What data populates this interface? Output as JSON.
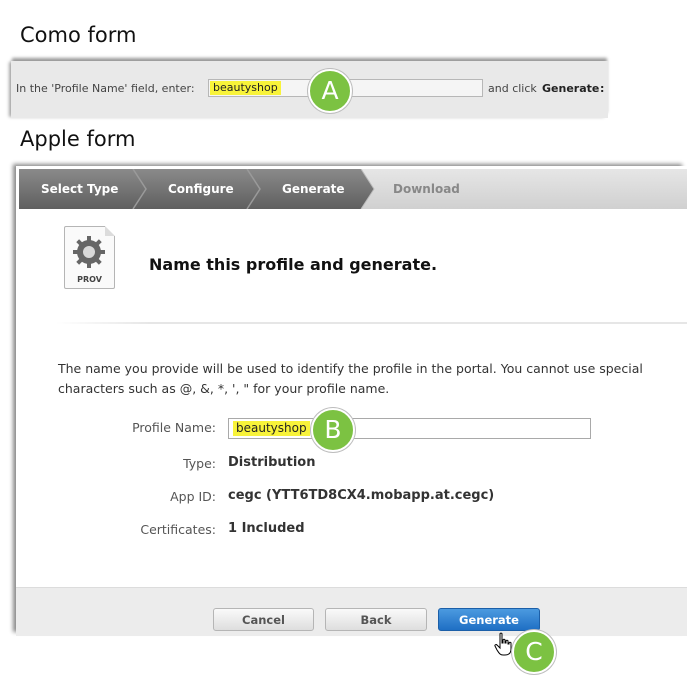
{
  "como": {
    "title": "Como form",
    "instruction_prefix": "In the 'Profile Name' field, enter:",
    "field_value": "beautyshop",
    "instruction_suffix": "and click",
    "generate_label": "Generate",
    "colon": ":"
  },
  "apple": {
    "title": "Apple form",
    "steps": [
      "Select Type",
      "Configure",
      "Generate",
      "Download"
    ],
    "icon_label": "PROV",
    "heading": "Name this profile and generate.",
    "description": "The name you provide will be used to identify the profile in the portal. You cannot use special characters such as @, &, *, ', \" for your profile name.",
    "fields": {
      "profile_name_label": "Profile Name:",
      "profile_name_value": "beautyshop",
      "type_label": "Type:",
      "type_value": "Distribution",
      "app_id_label": "App ID:",
      "app_id_value": "cegc (YTT6TD8CX4.mobapp.at.cegc)",
      "certificates_label": "Certificates:",
      "certificates_value": "1 Included"
    },
    "buttons": {
      "cancel": "Cancel",
      "back": "Back",
      "generate": "Generate"
    }
  },
  "callouts": {
    "a": "A",
    "b": "B",
    "c": "C"
  },
  "colors": {
    "callout_green": "#7cc242",
    "highlight_yellow": "#f8f33a",
    "active_step": "#6f6f6f",
    "primary_button": "#2a7fd4"
  }
}
